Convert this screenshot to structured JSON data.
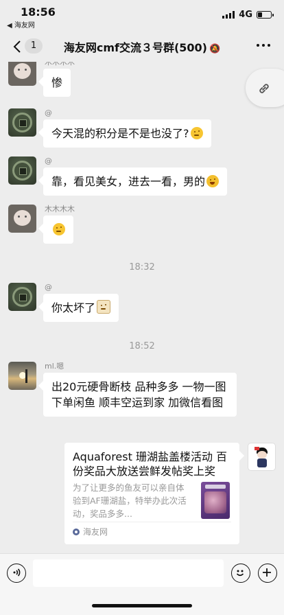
{
  "status_bar": {
    "time": "18:56",
    "back_app": "◀ 海友网",
    "network": "4G",
    "battery_level": 0.35
  },
  "nav": {
    "unread_badge": "1",
    "title": "海友网cmf交流３号群(500)"
  },
  "messages": [
    {
      "nickname": "木木木木",
      "text": "惨",
      "avatar": "bear-avatar"
    },
    {
      "nickname": "@",
      "text": "今天混的积分是不是也没了?",
      "emoji": "thinking-emoji",
      "avatar": "coin-avatar"
    },
    {
      "nickname": "@",
      "text": "靠，看见美女，进去一看，男的",
      "emoji": "laughing-emoji",
      "avatar": "coin-avatar"
    },
    {
      "nickname": "木木木木",
      "text": "",
      "emoji": "thinking-emoji",
      "avatar": "bear-avatar"
    },
    {
      "nickname": "@",
      "text": "你太坏了",
      "emoji": "bad-emoji",
      "avatar": "coin-avatar"
    },
    {
      "nickname": "ml.嗯",
      "text": "出20元硬骨断枝 品种多多 一物一图 下单闲鱼 顺丰空运到家 加微信看图",
      "avatar": "sunset-avatar"
    }
  ],
  "timestamps": [
    "18:32",
    "18:52"
  ],
  "link_card": {
    "title": "Aquaforest 珊湖盐盖楼活动 百份奖品大放送尝鲜发帖奖上奖",
    "description": "为了让更多的鱼友可以亲自体验到AF珊湖盐，特举办此次活动，奖品多多...",
    "source": "海友网"
  },
  "input": {
    "value": ""
  }
}
